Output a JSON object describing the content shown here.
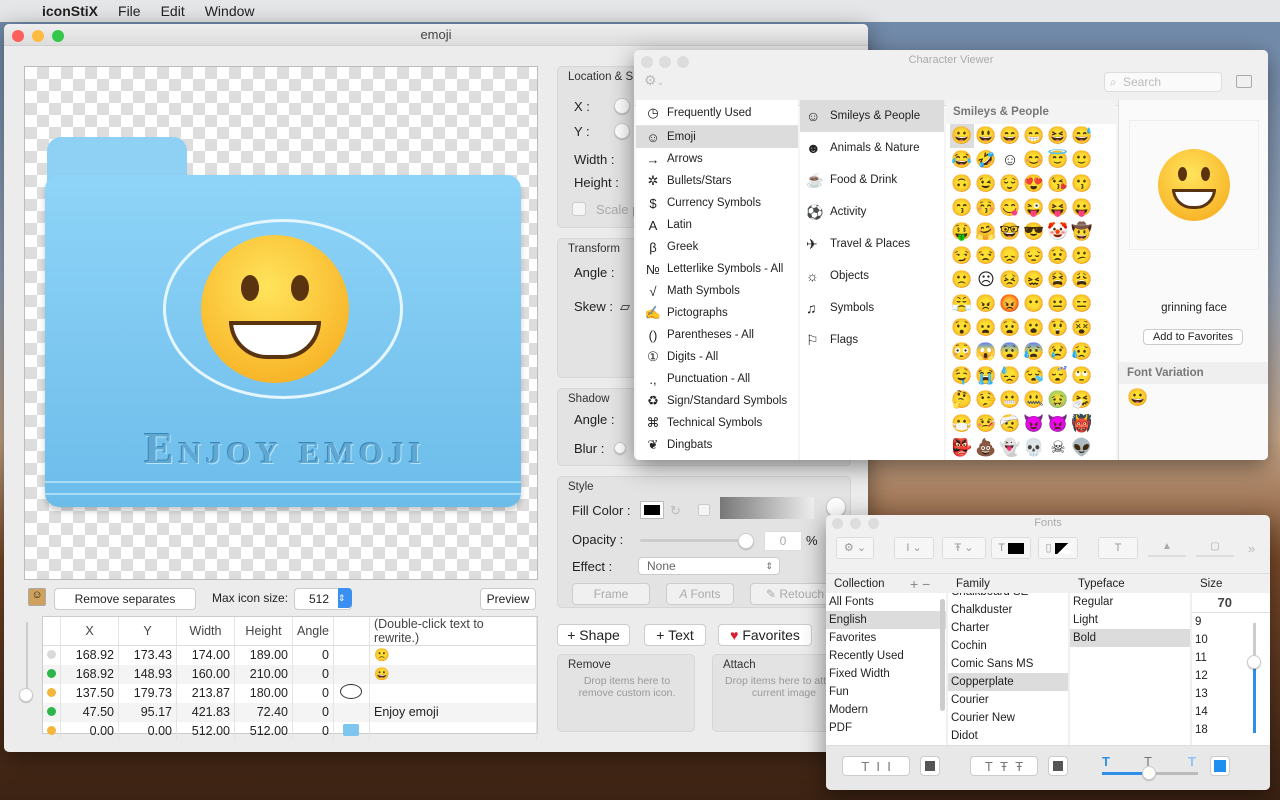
{
  "menubar": {
    "app": "iconStiX",
    "items": [
      "File",
      "Edit",
      "Window"
    ]
  },
  "main_window": {
    "title": "emoji",
    "canvas": {
      "text": "Enjoy emoji",
      "emoji": "😀"
    },
    "bottom": {
      "remove_separates": "Remove separates",
      "max_icon_size_label": "Max icon size:",
      "max_icon_size": "512",
      "preview": "Preview"
    },
    "table": {
      "headers": [
        "X",
        "Y",
        "Width",
        "Height",
        "Angle",
        "",
        "(Double-click text to rewrite.)"
      ],
      "rows": [
        {
          "status": "#d9d9d9",
          "x": "168.92",
          "y": "173.43",
          "w": "174.00",
          "h": "189.00",
          "angle": "0",
          "thumb": "",
          "text": "🙁"
        },
        {
          "status": "#2bb54b",
          "x": "168.92",
          "y": "148.93",
          "w": "160.00",
          "h": "210.00",
          "angle": "0",
          "thumb": "",
          "text": "😀"
        },
        {
          "status": "#f5b53a",
          "x": "137.50",
          "y": "179.73",
          "w": "213.87",
          "h": "180.00",
          "angle": "0",
          "thumb": "cloud",
          "text": ""
        },
        {
          "status": "#2bb54b",
          "x": "47.50",
          "y": "95.17",
          "w": "421.83",
          "h": "72.40",
          "angle": "0",
          "thumb": "",
          "text": "Enjoy emoji"
        },
        {
          "status": "#f5b53a",
          "x": "0.00",
          "y": "0.00",
          "w": "512.00",
          "h": "512.00",
          "angle": "0",
          "thumb": "folder",
          "text": ""
        }
      ]
    },
    "inspector": {
      "location": {
        "title": "Location & S",
        "x": "X :",
        "y": "Y :",
        "width": "Width :",
        "height": "Height :",
        "scale": "Scale p"
      },
      "transform": {
        "title": "Transform",
        "angle": "Angle :",
        "skew": "Skew :"
      },
      "shadow": {
        "title": "Shadow",
        "angle": "Angle :",
        "blur": "Blur :"
      },
      "style": {
        "title": "Style",
        "fill": "Fill Color :",
        "opacity": "Opacity :",
        "opacity_value": "0",
        "pct": "%",
        "effect": "Effect :",
        "effect_value": "None",
        "frame": "Frame",
        "fonts": "Fonts",
        "retouch": "Retouch"
      },
      "add_shape": "+ Shape",
      "add_text": "+ Text",
      "favorites": "Favorites",
      "remove": {
        "title": "Remove",
        "hint": "Drop items here to remove custom icon."
      },
      "attach": {
        "title": "Attach",
        "hint": "Drop items here to attach current image"
      }
    }
  },
  "character_viewer": {
    "title": "Character Viewer",
    "search_placeholder": "Search",
    "list": [
      {
        "icon": "◷",
        "label": "Frequently Used"
      },
      {
        "icon": "☺",
        "label": "Emoji"
      },
      {
        "icon": "→",
        "label": "Arrows"
      },
      {
        "icon": "✲",
        "label": "Bullets/Stars"
      },
      {
        "icon": "$",
        "label": "Currency Symbols"
      },
      {
        "icon": "A",
        "label": "Latin"
      },
      {
        "icon": "β",
        "label": "Greek"
      },
      {
        "icon": "№",
        "label": "Letterlike Symbols - All"
      },
      {
        "icon": "√",
        "label": "Math Symbols"
      },
      {
        "icon": "✍",
        "label": "Pictographs"
      },
      {
        "icon": "()",
        "label": "Parentheses - All"
      },
      {
        "icon": "①",
        "label": "Digits - All"
      },
      {
        "icon": ".,",
        "label": "Punctuation - All"
      },
      {
        "icon": "♻",
        "label": "Sign/Standard Symbols"
      },
      {
        "icon": "⌘",
        "label": "Technical Symbols"
      },
      {
        "icon": "❦",
        "label": "Dingbats"
      }
    ],
    "selected_list": "Emoji",
    "categories": [
      {
        "icon": "☺",
        "label": "Smileys & People"
      },
      {
        "icon": "☻",
        "label": "Animals & Nature"
      },
      {
        "icon": "☕",
        "label": "Food & Drink"
      },
      {
        "icon": "⚽",
        "label": "Activity"
      },
      {
        "icon": "✈",
        "label": "Travel & Places"
      },
      {
        "icon": "☼",
        "label": "Objects"
      },
      {
        "icon": "♫",
        "label": "Symbols"
      },
      {
        "icon": "⚐",
        "label": "Flags"
      }
    ],
    "grid_title": "Smileys & People",
    "emoji": [
      "😀",
      "😃",
      "😄",
      "😁",
      "😆",
      "😅",
      "😂",
      "🤣",
      "☺",
      "😊",
      "😇",
      "🙂",
      "🙃",
      "😉",
      "😌",
      "😍",
      "😘",
      "😗",
      "😙",
      "😚",
      "😋",
      "😜",
      "😝",
      "😛",
      "🤑",
      "🤗",
      "🤓",
      "😎",
      "🤡",
      "🤠",
      "😏",
      "😒",
      "😞",
      "😔",
      "😟",
      "😕",
      "🙁",
      "☹",
      "😣",
      "😖",
      "😫",
      "😩",
      "😤",
      "😠",
      "😡",
      "😶",
      "😐",
      "😑",
      "😯",
      "😦",
      "😧",
      "😮",
      "😲",
      "😵",
      "😳",
      "😱",
      "😨",
      "😰",
      "😢",
      "😥",
      "🤤",
      "😭",
      "😓",
      "😪",
      "😴",
      "🙄",
      "🤔",
      "🤥",
      "😬",
      "🤐",
      "🤢",
      "🤧",
      "😷",
      "🤒",
      "🤕",
      "😈",
      "👿",
      "👹",
      "👺",
      "💩",
      "👻",
      "💀",
      "☠",
      "👽"
    ],
    "detail": {
      "emoji": "😀",
      "name": "grinning face",
      "add_favorites": "Add to Favorites",
      "font_variation": "Font Variation"
    }
  },
  "fonts": {
    "title": "Fonts",
    "headers": {
      "collection": "Collection",
      "family": "Family",
      "typeface": "Typeface",
      "size": "Size"
    },
    "collections": [
      "All Fonts",
      "English",
      "Favorites",
      "Recently Used",
      "Fixed Width",
      "Fun",
      "Modern",
      "PDF"
    ],
    "families": [
      "Chalkboard SE",
      "Chalkduster",
      "Charter",
      "Cochin",
      "Comic Sans MS",
      "Copperplate",
      "Courier",
      "Courier New",
      "Didot"
    ],
    "typefaces": [
      "Regular",
      "Light",
      "Bold"
    ],
    "size_value": "70",
    "sizes": [
      "9",
      "10",
      "11",
      "12",
      "13",
      "14",
      "18"
    ],
    "selected": {
      "collection": "English",
      "family": "Copperplate",
      "typeface": "Bold"
    },
    "accent": "#2f8fe8"
  }
}
